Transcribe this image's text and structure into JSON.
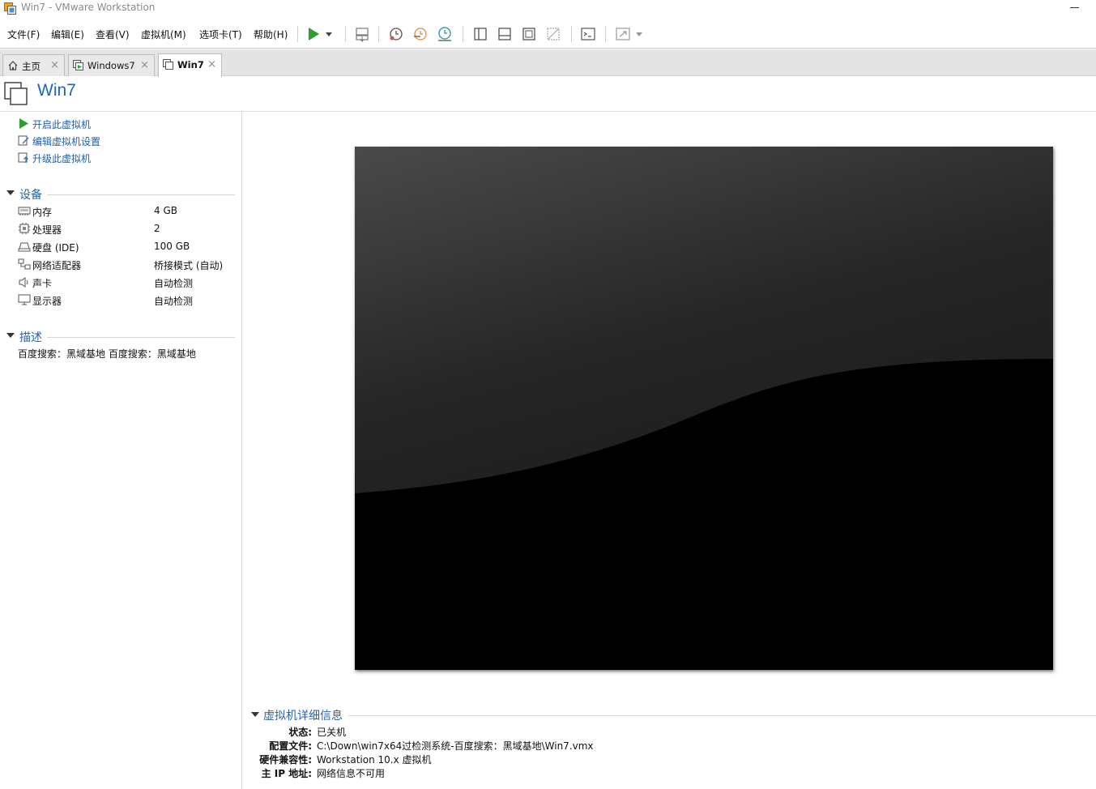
{
  "window": {
    "title": "Win7 - VMware Workstation"
  },
  "menu": [
    {
      "label": "文件(F)"
    },
    {
      "label": "编辑(E)"
    },
    {
      "label": "查看(V)"
    },
    {
      "label": "虚拟机(M)"
    },
    {
      "label": "选项卡(T)"
    },
    {
      "label": "帮助(H)"
    }
  ],
  "tabs": [
    {
      "label": "主页",
      "icon": "home-icon"
    },
    {
      "label": "Windows7",
      "icon": "vm-running-icon"
    },
    {
      "label": "Win7",
      "icon": "vm-icon",
      "active": true
    }
  ],
  "tab_close_glyph": "×",
  "page": {
    "title": "Win7"
  },
  "actions": [
    {
      "label": "开启此虚拟机",
      "icon": "play-icon"
    },
    {
      "label": "编辑虚拟机设置",
      "icon": "edit-settings-icon"
    },
    {
      "label": "升级此虚拟机",
      "icon": "upgrade-icon"
    }
  ],
  "devices_section": {
    "label": "设备"
  },
  "devices": [
    {
      "name": "内存",
      "value": "4 GB",
      "icon": "memory-icon"
    },
    {
      "name": "处理器",
      "value": "2",
      "icon": "cpu-icon"
    },
    {
      "name": "硬盘 (IDE)",
      "value": "100 GB",
      "icon": "hard-disk-icon"
    },
    {
      "name": "网络适配器",
      "value": "桥接模式 (自动)",
      "icon": "network-adapter-icon"
    },
    {
      "name": "声卡",
      "value": "自动检测",
      "icon": "sound-card-icon"
    },
    {
      "name": "显示器",
      "value": "自动检测",
      "icon": "display-icon"
    }
  ],
  "description_section": {
    "label": "描述",
    "text": "百度搜索：黑域基地 百度搜索：黑域基地"
  },
  "details_section": {
    "label": "虚拟机详细信息"
  },
  "details": [
    {
      "key": "状态:",
      "value": "已关机"
    },
    {
      "key": "配置文件:",
      "value": "C:\\Down\\win7x64过检测系统-百度搜索：黑域基地\\Win7.vmx"
    },
    {
      "key": "硬件兼容性:",
      "value": "Workstation 10.x 虚拟机"
    },
    {
      "key": "主 IP 地址:",
      "value": "网络信息不可用"
    }
  ],
  "colors": {
    "accent": "#1f66b3",
    "link": "#1f5fb0",
    "play_green": "#2e9e2e",
    "section_blue": "#2c62a8"
  }
}
